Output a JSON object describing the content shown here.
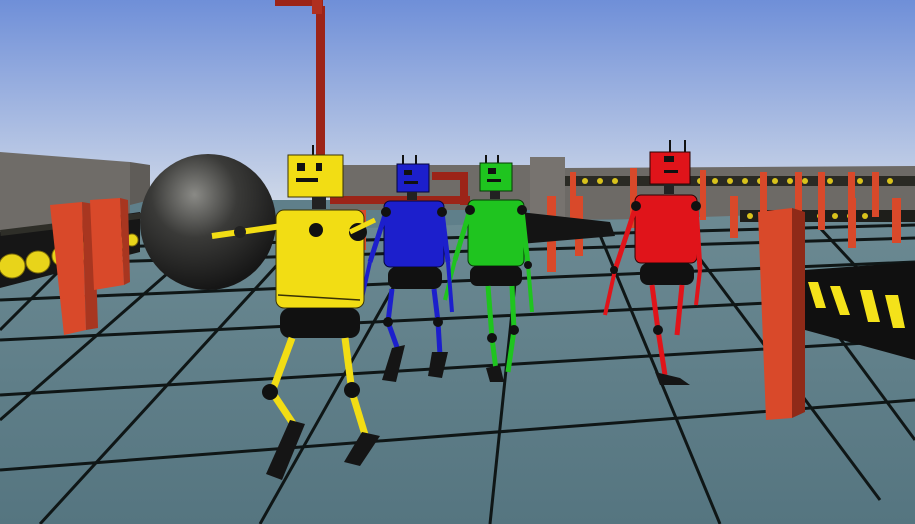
{
  "scene": {
    "robots": [
      {
        "name": "yellow",
        "color": "#f2dd14"
      },
      {
        "name": "blue",
        "color": "#1c1fcc"
      },
      {
        "name": "green",
        "color": "#1fc41f"
      },
      {
        "name": "red",
        "color": "#e0141a"
      }
    ],
    "colors": {
      "sky_top": "#6f8fd8",
      "sky_bottom": "#c9d4e6",
      "floor": "#5d7b85",
      "grid_line": "#0e1414",
      "wall": "#6e6b67",
      "pillar": "#e0502a",
      "pipe": "#9c2418",
      "bomb": "#2e2e2e",
      "hazard_yellow": "#f4e21a"
    }
  }
}
